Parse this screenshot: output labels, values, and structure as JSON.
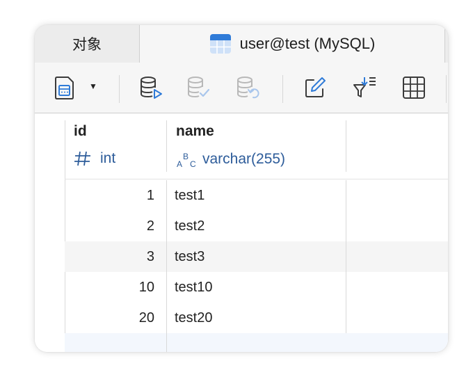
{
  "tabs": {
    "objects_label": "对象",
    "active_label": "user@test (MySQL)"
  },
  "toolbar": {
    "buttons": [
      {
        "name": "new-query",
        "icon": "calculator-doc-icon"
      },
      {
        "name": "begin-transaction",
        "icon": "database-play-icon"
      },
      {
        "name": "commit",
        "icon": "database-check-icon"
      },
      {
        "name": "rollback",
        "icon": "database-revert-icon"
      },
      {
        "name": "edit",
        "icon": "pencil-icon"
      },
      {
        "name": "filter-sort",
        "icon": "filter-sort-icon"
      },
      {
        "name": "grid-view",
        "icon": "grid-icon"
      }
    ],
    "caret": "▼"
  },
  "columns": [
    {
      "name": "id",
      "type_icon": "#",
      "type": "int"
    },
    {
      "name": "name",
      "type_icon": "ABC",
      "type": "varchar(255)"
    }
  ],
  "rows": [
    {
      "id": "1",
      "name": "test1"
    },
    {
      "id": "2",
      "name": "test2"
    },
    {
      "id": "3",
      "name": "test3"
    },
    {
      "id": "10",
      "name": "test10"
    },
    {
      "id": "20",
      "name": "test20"
    }
  ],
  "colors": {
    "accent": "#2f7bd8",
    "type_text": "#2d5c9a",
    "icon_gray": "#3a3a3a",
    "icon_disabled": "#b8b8b8",
    "row_alt": "#f5f5f5",
    "row_new": "#f3f7fd"
  }
}
